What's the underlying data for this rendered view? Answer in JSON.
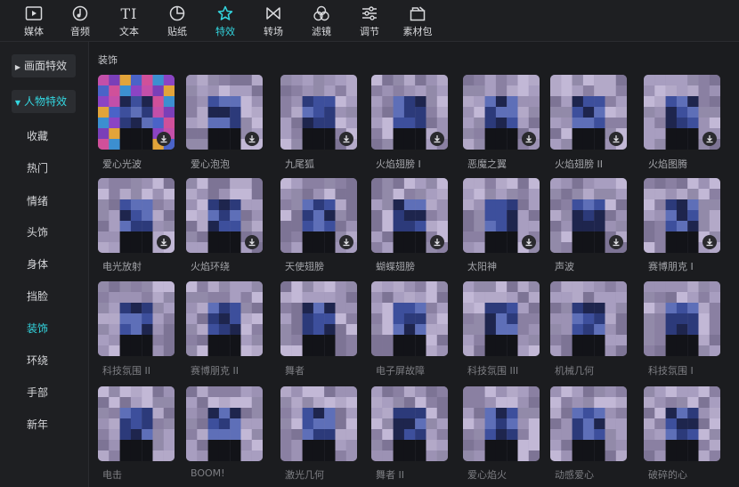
{
  "toolbar": {
    "items": [
      {
        "label": "媒体",
        "icon": "media-icon"
      },
      {
        "label": "音频",
        "icon": "audio-icon"
      },
      {
        "label": "文本",
        "icon": "text-icon"
      },
      {
        "label": "贴纸",
        "icon": "sticker-icon"
      },
      {
        "label": "特效",
        "icon": "effects-icon",
        "active": true
      },
      {
        "label": "转场",
        "icon": "transition-icon"
      },
      {
        "label": "滤镜",
        "icon": "filter-icon"
      },
      {
        "label": "调节",
        "icon": "adjust-icon"
      },
      {
        "label": "素材包",
        "icon": "material-pack-icon"
      }
    ],
    "text_icon_glyph": "TI"
  },
  "sidebar": {
    "screen_effects": "画面特效",
    "character_effects": "人物特效",
    "items": [
      "收藏",
      "热门",
      "情绪",
      "头饰",
      "身体",
      "挡脸",
      "装饰",
      "环绕",
      "手部",
      "新年"
    ],
    "active_item": "装饰"
  },
  "section_title": "装饰",
  "grid": {
    "rows": [
      [
        "爱心光波",
        "爱心泡泡",
        "九尾狐",
        "火焰翅膀 I",
        "恶魔之翼",
        "火焰翅膀 II",
        "火焰图腾"
      ],
      [
        "电光放射",
        "火焰环绕",
        "天使翅膀",
        "蝴蝶翅膀",
        "太阳神",
        "声波",
        "赛博朋克 I"
      ],
      [
        "科技氛围 II",
        "赛博朋克 II",
        "舞者",
        "电子屏故障",
        "科技氛围 III",
        "机械几何",
        "科技氛围 I"
      ],
      [
        "电击",
        "BOOM!",
        "激光几何",
        "舞者 II",
        "爱心焰火",
        "动感爱心",
        "破碎的心"
      ]
    ]
  },
  "colors": {
    "accent": "#33d6e0",
    "background": "#1b1c1f",
    "panel": "#1e1f22",
    "thumb_base": "#8e86a6"
  }
}
